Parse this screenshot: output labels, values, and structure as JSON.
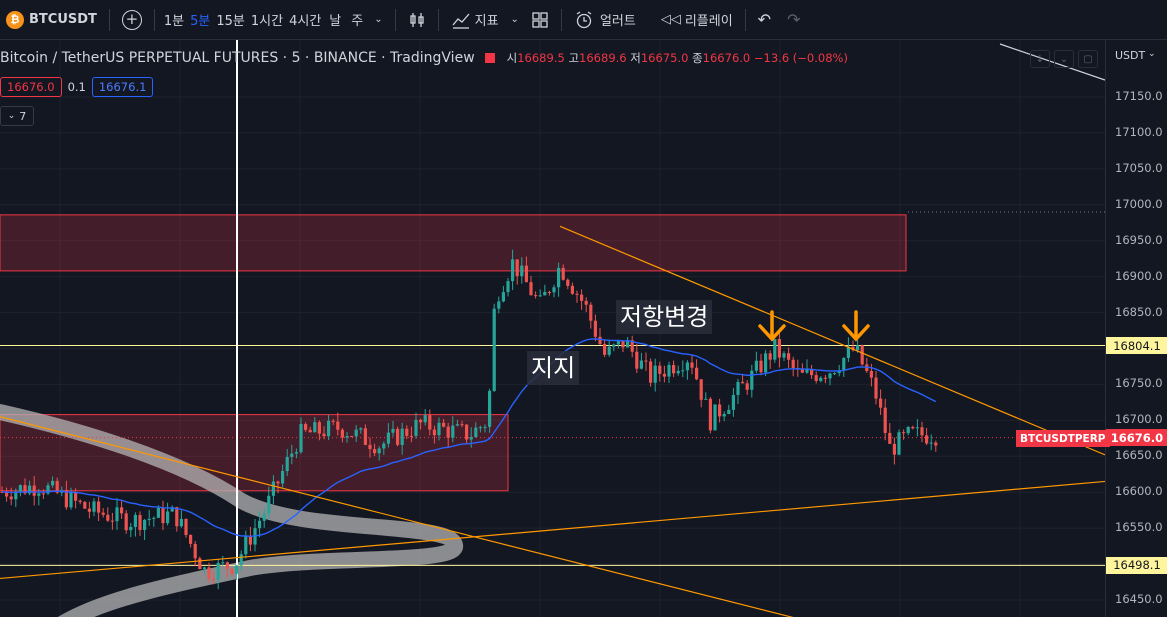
{
  "toolbar": {
    "symbol": "BTCUSDT",
    "symbol_icon": "bitcoin-icon",
    "timeframes": [
      "1분",
      "5분",
      "15분",
      "1시간",
      "4시간",
      "날",
      "주"
    ],
    "active_timeframe": "5분",
    "indicators_label": "지표",
    "alert_label": "얼러트",
    "replay_label": "리플레이"
  },
  "legend": {
    "title": "Bitcoin / TetherUS PERPETUAL FUTURES · 5 · BINANCE · TradingView",
    "open_label": "시",
    "open": "16689.5",
    "high_label": "고",
    "high": "16689.6",
    "low_label": "저",
    "low": "16675.0",
    "close_label": "종",
    "close": "16676.0",
    "change": "−13.6 (−0.08%)",
    "bid": "16676.0",
    "spread": "0.1",
    "ask": "16676.1",
    "indicator_count": "7"
  },
  "axis": {
    "currency": "USDT",
    "ticks": [
      "17150.0",
      "17100.0",
      "17050.0",
      "17000.0",
      "16950.0",
      "16900.0",
      "16850.0",
      "16800.0",
      "16750.0",
      "16700.0",
      "16650.0",
      "16600.0",
      "16550.0",
      "16500.0",
      "16450.0"
    ],
    "level_upper": "16804.1",
    "level_lower": "16498.1",
    "last_price": "16676.0",
    "last_price_tag": "BTCUSDTPERP"
  },
  "annotations": {
    "resistance_change": "저항변경",
    "support": "지지"
  },
  "colors": {
    "background": "#131722",
    "up": "#26a69a",
    "down": "#ef5350",
    "ma": "#2962ff",
    "trendline": "#ff9800",
    "level": "#fff59d",
    "zone": "#f23645"
  },
  "chart_data": {
    "type": "candlestick",
    "symbol": "BTCUSDT",
    "interval": "5",
    "ylim": [
      16430,
      17190
    ],
    "horizontal_levels": [
      16804.1,
      16498.1
    ],
    "last_price": 16676.0,
    "zones": [
      {
        "low": 16908,
        "high": 16986
      },
      {
        "low": 16602,
        "high": 16708
      }
    ]
  }
}
